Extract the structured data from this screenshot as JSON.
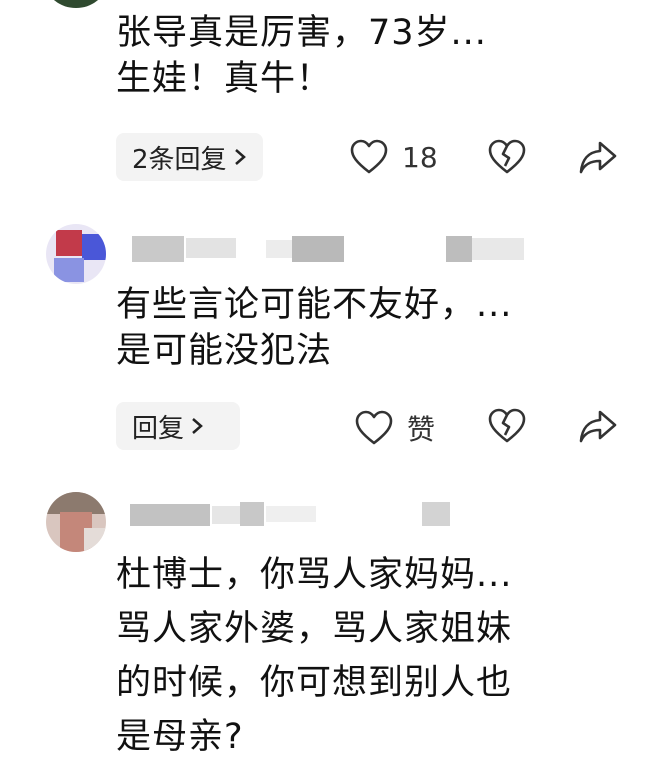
{
  "comments": [
    {
      "text_line1": "张导真是厉害，73岁...",
      "text_line2": "生娃！真牛！",
      "reply_label": "2条回复",
      "like_count": "18"
    },
    {
      "text_line1": "有些言论可能不友好，...",
      "text_line2": "是可能没犯法",
      "reply_label": "回复",
      "like_count": "赞"
    },
    {
      "text_line1": "杜博士，你骂人家妈妈...",
      "text_line2": "骂人家外婆，骂人家姐妹",
      "text_line3": "的时候，你可想到别人也",
      "text_line4": "是母亲?"
    }
  ],
  "icons": {
    "like": "heart-icon",
    "dislike": "broken-heart-icon",
    "share": "share-arrow-icon",
    "reply_chevron": "chevron-right-icon"
  },
  "colors": {
    "text": "#111111",
    "reply_bg": "#f3f3f3",
    "icon_stroke": "#333333"
  }
}
